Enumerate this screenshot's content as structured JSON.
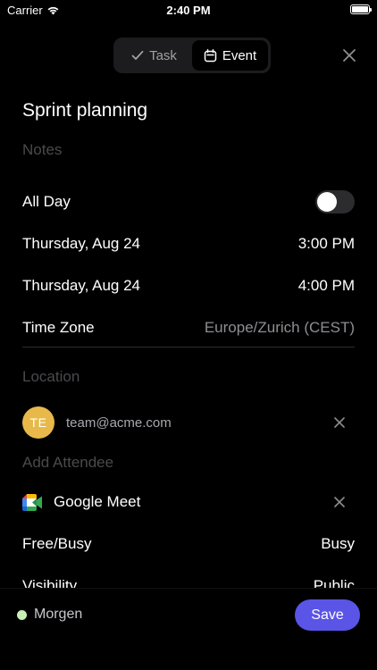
{
  "status_bar": {
    "carrier": "Carrier",
    "time": "2:40 PM",
    "wifi_icon": "wifi-icon",
    "battery_icon": "battery-icon"
  },
  "segmented": {
    "task_label": "Task",
    "event_label": "Event",
    "selected": "Event"
  },
  "event": {
    "title": "Sprint planning",
    "notes_placeholder": "Notes",
    "all_day_label": "All Day",
    "all_day_on": false,
    "start_date": "Thursday, Aug 24",
    "start_time": "3:00 PM",
    "end_date": "Thursday, Aug 24",
    "end_time": "4:00 PM",
    "time_zone_label": "Time Zone",
    "time_zone_value": "Europe/Zurich (CEST)",
    "location_placeholder": "Location",
    "attendee": {
      "initials": "TE",
      "email": "team@acme.com",
      "avatar_color": "#e8b94a"
    },
    "add_attendee_placeholder": "Add Attendee",
    "conference": "Google Meet",
    "free_busy_label": "Free/Busy",
    "free_busy_value": "Busy",
    "visibility_label": "Visibility",
    "visibility_value": "Public"
  },
  "footer": {
    "account_label": "Morgen",
    "account_dot_color": "#c8f0b4",
    "save_label": "Save",
    "save_color": "#5a55e6"
  }
}
